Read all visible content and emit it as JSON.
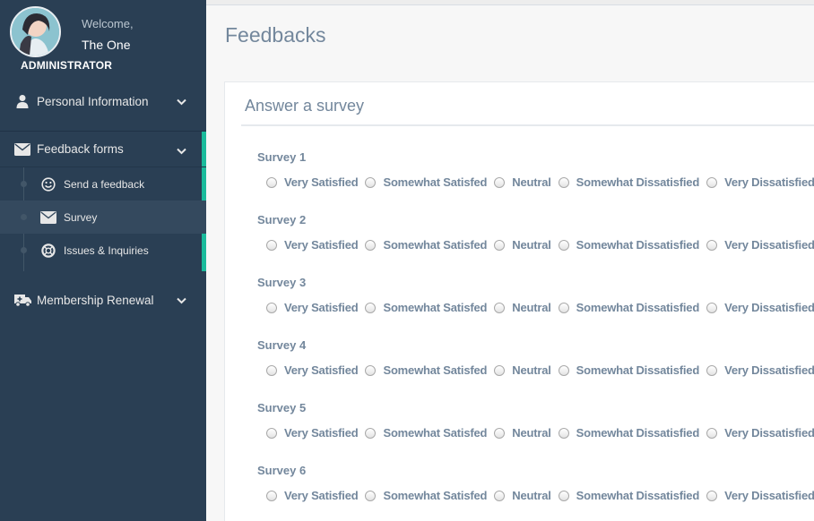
{
  "profile": {
    "welcome": "Welcome,",
    "name": "The One",
    "role": "ADMINISTRATOR"
  },
  "sidebar": {
    "personal": {
      "label": "Personal Information",
      "icon": "user-icon"
    },
    "feedback": {
      "label": "Feedback forms",
      "icon": "envelope-icon",
      "items": [
        {
          "label": "Send a feedback",
          "icon": "smile-icon"
        },
        {
          "label": "Survey",
          "icon": "envelope-icon",
          "current": true
        },
        {
          "label": "Issues & Inquiries",
          "icon": "lifebuoy-icon"
        }
      ]
    },
    "membership": {
      "label": "Membership Renewal",
      "icon": "ambulance-icon"
    }
  },
  "page": {
    "title": "Feedbacks"
  },
  "panel": {
    "title": "Answer a survey"
  },
  "options": [
    "Very Satisfied",
    "Somewhat Satisfed",
    "Neutral",
    "Somewhat Dissatisfied",
    "Very Dissatisfied"
  ],
  "surveys": [
    "Survey 1",
    "Survey 2",
    "Survey 3",
    "Survey 4",
    "Survey 5",
    "Survey 6"
  ],
  "colors": {
    "sidebar": "#2a3f54",
    "accent": "#1abb9c",
    "text": "#73879c"
  }
}
